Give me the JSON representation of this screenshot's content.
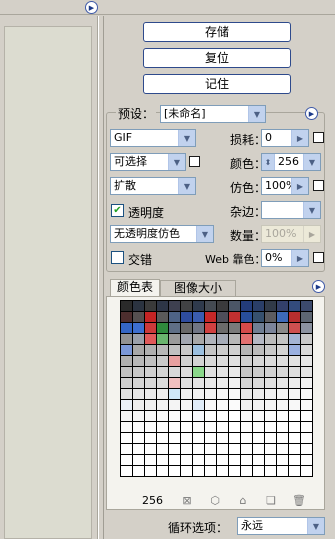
{
  "buttons": {
    "save": "存储",
    "reset": "复位",
    "remember": "记住"
  },
  "preset": {
    "label": "预设：",
    "value": "[未命名]"
  },
  "format": {
    "value": "GIF"
  },
  "reduction": {
    "value": "可选择"
  },
  "dither_algo": {
    "value": "扩散"
  },
  "transparency": {
    "label": "透明度",
    "checked": true
  },
  "matte_dither": {
    "value": "无透明度仿色"
  },
  "interlaced": {
    "label": "交错",
    "checked": false
  },
  "lossy": {
    "label": "损耗：",
    "value": "0"
  },
  "colors": {
    "label": "颜色：",
    "value": "256"
  },
  "dither": {
    "label": "仿色：",
    "value": "100%"
  },
  "matte": {
    "label": "杂边：",
    "value": ""
  },
  "amount": {
    "label": "数量：",
    "value": "100%",
    "disabled": true
  },
  "web_snap": {
    "label": "Web 靠色：",
    "value": "0%"
  },
  "tabs": [
    "颜色表",
    "图像大小"
  ],
  "color_table": {
    "columns": 16,
    "total": "256",
    "colors": [
      "#2a2a2a",
      "#2b3340",
      "#3a3a3a",
      "#2d3546",
      "#3e4050",
      "#414244",
      "#2f3a4c",
      "#444a52",
      "#3a3a3c",
      "#4b5666",
      "#233c7a",
      "#2a3e68",
      "#313a48",
      "#33406a",
      "#334b7c",
      "#3c4a6c",
      "#4d2e2e",
      "#555050",
      "#c42424",
      "#5a5a5a",
      "#4e6386",
      "#2e4c9e",
      "#3a5cb0",
      "#c62828",
      "#4e4e5a",
      "#c03030",
      "#284e9a",
      "#36506e",
      "#5c5c60",
      "#3d6aba",
      "#b82e2e",
      "#5d6672",
      "#3466c4",
      "#3d6fd0",
      "#cc3a3a",
      "#2f8a3c",
      "#5f6f86",
      "#686868",
      "#707584",
      "#d04040",
      "#6b6b6b",
      "#7a7a7a",
      "#d44a4a",
      "#6f7e94",
      "#7b849a",
      "#8a8a8a",
      "#cf5050",
      "#8b92a0",
      "#929292",
      "#9aa0aa",
      "#e05a5a",
      "#6ab46e",
      "#9a9a9a",
      "#a2a6b0",
      "#a8a8a8",
      "#b0b4bc",
      "#a6acb8",
      "#b8b8b8",
      "#e27070",
      "#b4b8c4",
      "#bcbcbc",
      "#c4c4c4",
      "#a4b4d4",
      "#c8c8c8",
      "#7b98d8",
      "#a8a8a8",
      "#b0b0b0",
      "#b8b8b8",
      "#c0c0c0",
      "#c8c8c8",
      "#9cc0e0",
      "#c4c4c4",
      "#cccccc",
      "#d0d0d0",
      "#b4b4b4",
      "#bcbcbc",
      "#c8c8c8",
      "#d4d4d4",
      "#9ab0e0",
      "#d8d8d8",
      "#b0b0b0",
      "#b8b8b8",
      "#c0c0c0",
      "#cacaca",
      "#e8a0a0",
      "#d0d0d0",
      "#d4d4d4",
      "#d8d8d8",
      "#dcdcdc",
      "#e0e0e0",
      "#cfcfcf",
      "#d6d6d6",
      "#dadada",
      "#dedede",
      "#e2e2e2",
      "#e6e6e6",
      "#c2c2c2",
      "#c8c8c8",
      "#d0d0d0",
      "#d4d4d4",
      "#d8d8d8",
      "#dcdcdc",
      "#8ad88a",
      "#e0e0e0",
      "#e4e4e4",
      "#e8e8e8",
      "#c6c6c6",
      "#cccccc",
      "#d2d2d2",
      "#d8d8d8",
      "#dedede",
      "#e4e4e4",
      "#d0d0d0",
      "#d4d4d4",
      "#d8d8d8",
      "#dcdcdc",
      "#f0c0c0",
      "#e0e0e0",
      "#e4e4e4",
      "#e8e8e8",
      "#ececec",
      "#f0f0f0",
      "#d4d4d4",
      "#dadada",
      "#e0e0e0",
      "#e6e6e6",
      "#ececec",
      "#f2f2f2",
      "#e2e2e2",
      "#e6e6e6",
      "#eaeaea",
      "#eeeeee",
      "#d0e8f8",
      "#f0f0f0",
      "#f2f2f2",
      "#f4f4f4",
      "#f6f6f6",
      "#f8f8f8",
      "#e8e8e8",
      "#ececec",
      "#f0f0f0",
      "#f4f4f4",
      "#f6f6f6",
      "#f8f8f8",
      "#eaf0f8",
      "#eeeeee",
      "#f0f0f0",
      "#f2f2f2",
      "#f4f4f4",
      "#f6f6f6",
      "#e0ecf8",
      "#f8f8f8",
      "#fafafa",
      "#fbfbfb",
      "#f0f0f0",
      "#f2f2f2",
      "#f4f4f4",
      "#f6f6f6",
      "#f8f8f8",
      "#fafafa",
      "#f4f4f4",
      "#f6f6f6",
      "#f8f8f8",
      "#fafafa",
      "#fbfbfb",
      "#fcfcfc",
      "#f6f8fc",
      "#fdfdfd",
      "#fefefe",
      "#ffffff",
      "#f8f8f8",
      "#fafafa",
      "#fcfcfc",
      "#fdfdfd",
      "#fefefe",
      "#ffffff",
      "#fafafa",
      "#fbfbfb",
      "#fcfcfc",
      "#fdfdfd",
      "#fefefe",
      "#ffffff",
      "#fcfcfc",
      "#fdfdfd",
      "#fefefe",
      "#ffffff",
      "#fcfcfc",
      "#fdfdfd",
      "#fefefe",
      "#ffffff",
      "#ffffff",
      "#ffffff",
      "#ffffff",
      "#ffffff",
      "#ffffff",
      "#ffffff",
      "#ffffff",
      "#ffffff",
      "#ffffff",
      "#ffffff",
      "#ffffff",
      "#ffffff",
      "#ffffff",
      "#ffffff",
      "#ffffff",
      "#ffffff",
      "#ffffff",
      "#ffffff",
      "#ffffff",
      "#ffffff",
      "#ffffff",
      "#ffffff",
      "#ffffff",
      "#ffffff",
      "#ffffff",
      "#ffffff",
      "#ffffff",
      "#ffffff",
      "#ffffff",
      "#ffffff",
      "#ffffff",
      "#ffffff",
      "#ffffff",
      "#ffffff",
      "#ffffff",
      "#ffffff",
      "#ffffff",
      "#ffffff",
      "#ffffff",
      "#ffffff",
      "#ffffff",
      "#ffffff",
      "#ffffff",
      "#ffffff",
      "#ffffff",
      "#ffffff",
      "#ffffff",
      "#ffffff",
      "#ffffff",
      "#ffffff",
      "#ffffff",
      "#ffffff",
      "#ffffff",
      "#ffffff",
      "#ffffff",
      "#ffffff",
      "#ffffff",
      "#ffffff",
      "#ffffff",
      "#ffffff",
      "#ffffff",
      "#ffffff",
      "#ffffff",
      "#ffffff",
      "#ffffff",
      "#ffffff"
    ]
  },
  "loop": {
    "label": "循环选项：",
    "value": "永远"
  },
  "icons": {
    "top_menu": "circle-arrow-icon",
    "settings_menu": "circle-arrow-icon",
    "table_menu": "circle-arrow-icon",
    "bottom": [
      "map-to-transparent-icon",
      "web-shift-icon",
      "lock-icon",
      "new-color-icon",
      "trash-icon"
    ]
  }
}
